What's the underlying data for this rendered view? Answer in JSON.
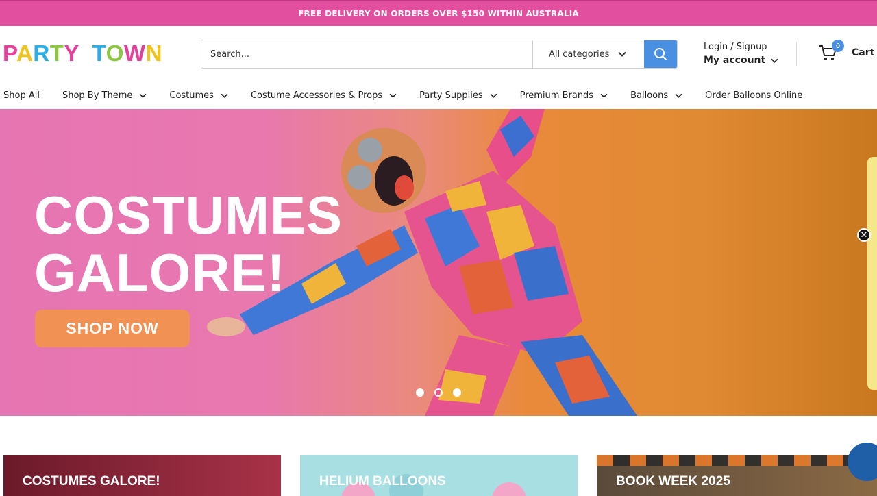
{
  "announcement": "FREE DELIVERY ON ORDERS OVER $150 WITHIN AUSTRALIA",
  "logo": {
    "word1": "PARTY",
    "word2": "TOWN"
  },
  "search": {
    "placeholder": "Search...",
    "category": "All categories"
  },
  "account": {
    "login": "Login / Signup",
    "my_account": "My account"
  },
  "cart": {
    "count": "0",
    "label": "Cart"
  },
  "nav": [
    {
      "label": "Shop All",
      "dropdown": false
    },
    {
      "label": "Shop By Theme",
      "dropdown": true
    },
    {
      "label": "Costumes",
      "dropdown": true
    },
    {
      "label": "Costume Accessories & Props",
      "dropdown": true
    },
    {
      "label": "Party Supplies",
      "dropdown": true
    },
    {
      "label": "Premium Brands",
      "dropdown": true
    },
    {
      "label": "Balloons",
      "dropdown": true
    },
    {
      "label": "Order Balloons Online",
      "dropdown": false
    }
  ],
  "hero": {
    "title_line1": "COSTUMES",
    "title_line2": "GALORE!",
    "button": "SHOP NOW",
    "slides": 3,
    "active_slide": 1
  },
  "cards": [
    {
      "label": "COSTUMES GALORE!"
    },
    {
      "label": "HELIUM BALLOONS"
    },
    {
      "label": "BOOK WEEK 2025"
    }
  ],
  "colors": {
    "brand_pink": "#e24f9e",
    "accent_blue": "#4a90e2",
    "shop_button": "#f19153"
  }
}
